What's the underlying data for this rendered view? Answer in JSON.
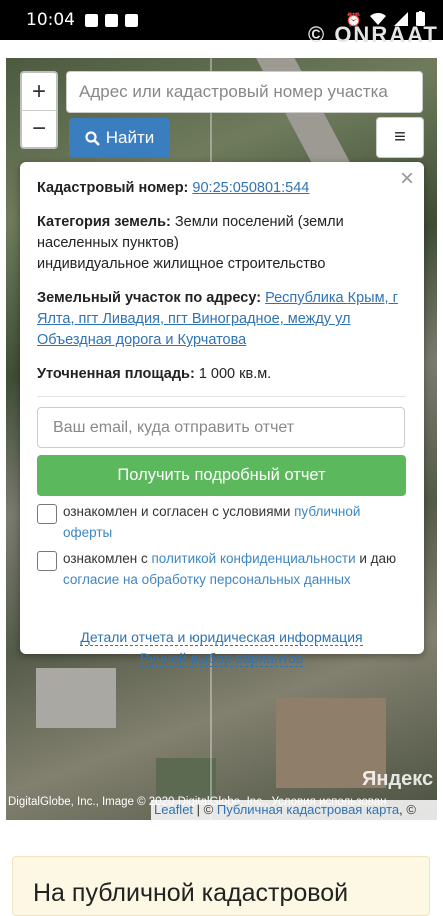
{
  "status_bar": {
    "time": "10:04"
  },
  "map": {
    "zoom_in": "+",
    "zoom_out": "−",
    "search_placeholder": "Адрес или кадастровый номер участка",
    "find_label": "Найти",
    "menu_glyph": "≡",
    "yandex_label": "Яндекс",
    "attribution_left": "DigitalGlobe, Inc., Image © 2020 DigitalGlobe, Inc., Условия использован",
    "attribution_leaflet": "Leaflet",
    "attribution_sep": " | © ",
    "attribution_pkk": "Публичная кадастровая карта",
    "attribution_tail": ", ©"
  },
  "popup": {
    "close": "×",
    "cad_label": "Кадастровый номер:",
    "cad_value": "90:25:050801:544",
    "cat_label": "Категория земель:",
    "cat_value": "Земли поселений (земли населенных пунктов)",
    "cat_use": "индивидуальное жилищное строительство",
    "addr_label": "Земельный участок по адресу:",
    "addr_value": "Республика Крым, г Ялта, пгт Ливадия, пгт Виноградное, между ул Объездная дорога и Курчатова",
    "area_label": "Уточненная площадь:",
    "area_value": "1 000 кв.м.",
    "email_placeholder": "Ваш email, куда отправить отчет",
    "report_button": "Получить подробный отчет",
    "check1_text": "ознакомлен и согласен с условиями ",
    "check1_link": "публичной оферты",
    "check2_text1": "ознакомлен с ",
    "check2_link1": "политикой конфиденциальности",
    "check2_text2": " и даю ",
    "check2_link2": "согласие на обработку персональных данных",
    "link_details": "Детали отчета и юридическая информация",
    "link_manual": "Ручной выбор вариантов"
  },
  "bottom_card": {
    "title": "На публичной кадастровой"
  },
  "colors": {
    "primary": "#3a7ec0",
    "success": "#5cb85c",
    "link": "#2f73b4"
  }
}
